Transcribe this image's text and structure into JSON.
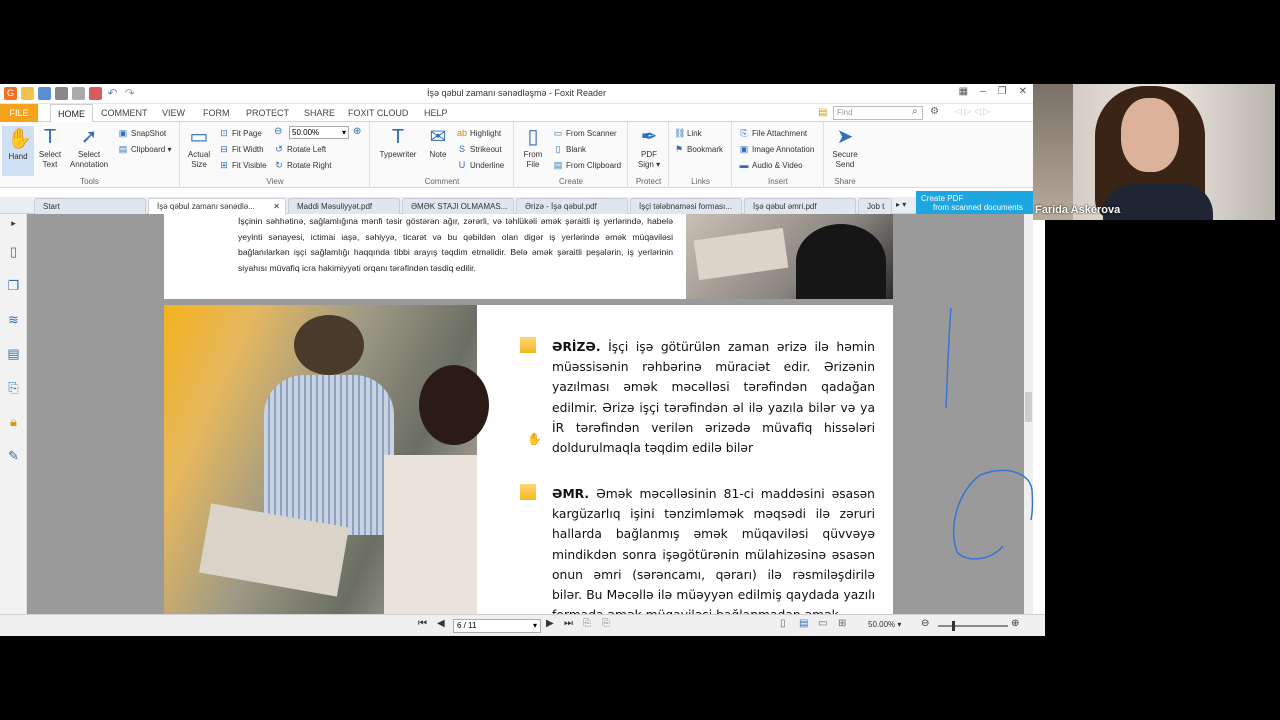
{
  "window": {
    "title": "İşə qəbul zamanı sənədləşmə - Foxit Reader"
  },
  "menu": {
    "items": [
      "FILE",
      "HOME",
      "COMMENT",
      "VIEW",
      "FORM",
      "PROTECT",
      "SHARE",
      "FOXIT CLOUD",
      "HELP"
    ],
    "active": "HOME",
    "find_placeholder": "Find"
  },
  "ribbon": {
    "tools": {
      "hand": "Hand",
      "select_text": "Select Text",
      "select_annotation": "Select Annotation",
      "snapshot": "SnapShot",
      "clipboard": "Clipboard",
      "label": "Tools"
    },
    "view": {
      "actual_size": "Actual Size",
      "fit_page": "Fit Page",
      "fit_width": "Fit Width",
      "fit_visible": "Fit Visible",
      "zoom": "50.00%",
      "rotate_left": "Rotate Left",
      "rotate_right": "Rotate Right",
      "label": "View"
    },
    "comment": {
      "typewriter": "Typewriter",
      "note": "Note",
      "highlight": "Highlight",
      "strikeout": "Strikeout",
      "underline": "Underline",
      "label": "Comment"
    },
    "create": {
      "from_file": "From File",
      "from_scanner": "From Scanner",
      "blank": "Blank",
      "from_clipboard": "From Clipboard",
      "label": "Create"
    },
    "protect": {
      "pdf_sign": "PDF Sign",
      "label": "Protect"
    },
    "links": {
      "link": "Link",
      "bookmark": "Bookmark",
      "label": "Links"
    },
    "insert": {
      "file_attachment": "File Attachment",
      "image_annotation": "Image Annotation",
      "audio_video": "Audio & Video",
      "label": "Insert"
    },
    "share": {
      "secure_send": "Secure Send",
      "label": "Share"
    }
  },
  "tabs": [
    "Start",
    "İşə qəbul zamanı sənədlə...",
    "Maddi Məsuliyyət.pdf",
    "ƏMƏK STAJI OLMAMAS...",
    "Ərizə - İşə qəbul.pdf",
    "İşçi tələbnaməsi forması...",
    "İşə qəbul əmri.pdf",
    "Job t"
  ],
  "create_pdf": {
    "line1": "Create PDF",
    "line2": "from scanned documents"
  },
  "document": {
    "top_paragraph": "İşçinin səhhətinə, sağlamlığına mənfi təsir göstərən ağır, zərərli, və təhlükəli əmək şəraitli iş yerlərində, habelə yeyinti sənayesi, ictimai iaşə, səhiyyə, ticarət və bu qəbildən olan digər iş yerlərində əmək müqaviləsi bağlanılarkən işçi sağlamlığı haqqında tibbi arayış təqdim etməlidir. Belə əmək şəraitli peşələrin, iş yerlərinin siyahısı müvafiq icra hakimiyyəti orqanı tərəfindən təsdiq edilir.",
    "item1_title": "ƏRİZƏ.",
    "item1_text": "İşçi işə götürülən zaman ərizə ilə həmin müəssisənin rəhbərinə müraciət edir. Ərizənin yazılması əmək məcəlləsi tərəfindən qadağan edilmir. Ərizə işçi tərəfindən əl ilə yazıla bilər və ya İR tərəfindən verilən ərizədə müvafiq hissələri doldurulmaqla təqdim edilə bilər",
    "item2_title": "ƏMR.",
    "item2_text": "Əmək məcəlləsinin 81-ci maddəsini əsasən kargüzarlıq işini tənzimləmək məqsədi ilə zəruri hallarda bağlanmış əmək müqaviləsi qüvvəyə mindikdən sonra işəgötürənin mülahizəsinə əsasən onun əmri (sərəncamı, qərarı) ilə rəsmiləşdirilə bilər. Bu Məcəllə ilə müəyyən edilmiş qaydada yazılı formada əmək müqaviləsi bağlanmadan əmək"
  },
  "status": {
    "page": "6 / 11",
    "zoom": "50.00%"
  },
  "participant": {
    "name": "Farida Askerova"
  },
  "colors": {
    "accent": "#f7a21b",
    "bullet": "#f5b81b",
    "ink": "#3a73d6"
  }
}
